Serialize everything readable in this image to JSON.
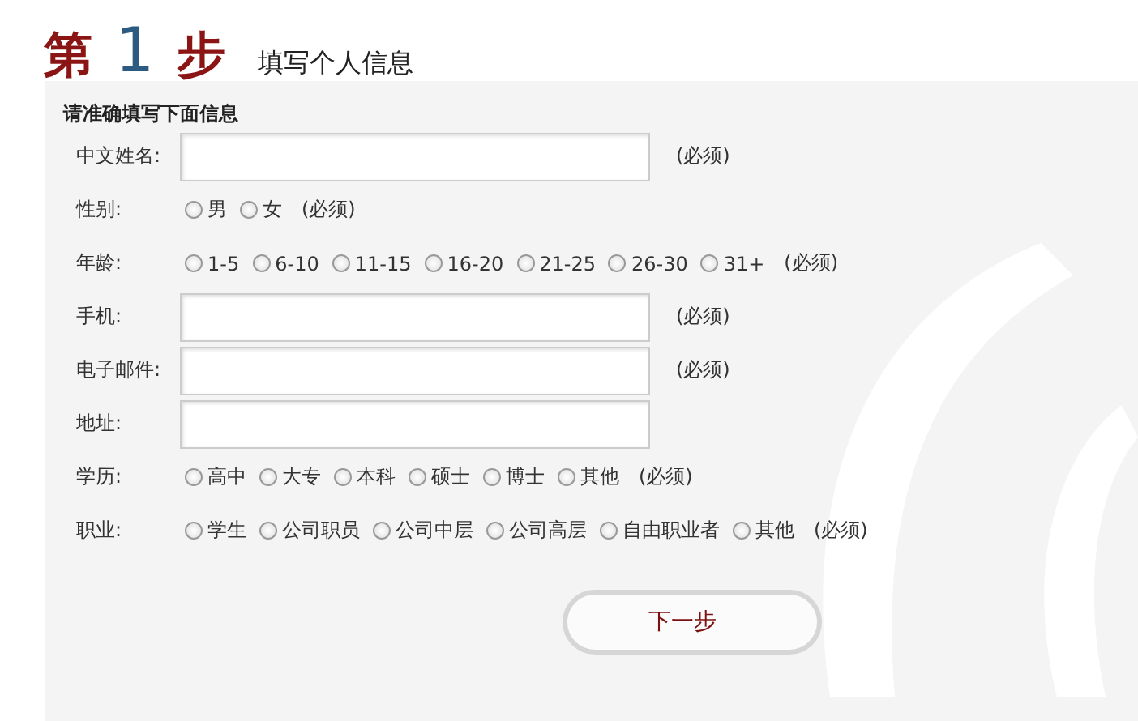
{
  "heading": {
    "step_word_1": "第",
    "step_number": "1",
    "step_word_2": "步",
    "subtitle": "填写个人信息"
  },
  "form": {
    "title": "请准确填写下面信息",
    "rows": [
      {
        "kind": "text",
        "label": "中文姓名:",
        "note": "(必须)"
      },
      {
        "kind": "radio",
        "label": "性别:",
        "options": [
          {
            "label": "男",
            "selected": false
          },
          {
            "label": "女",
            "selected": false
          }
        ],
        "note": "(必须)"
      },
      {
        "kind": "radio",
        "label": "年龄:",
        "options": [
          {
            "label": "1-5",
            "selected": false
          },
          {
            "label": "6-10",
            "selected": false
          },
          {
            "label": "11-15",
            "selected": false
          },
          {
            "label": "16-20",
            "selected": false
          },
          {
            "label": "21-25",
            "selected": false
          },
          {
            "label": "26-30",
            "selected": false
          },
          {
            "label": "31+",
            "selected": false
          }
        ],
        "note": "(必须)"
      },
      {
        "kind": "text",
        "label": "手机:",
        "note": "(必须)"
      },
      {
        "kind": "text",
        "label": "电子邮件:",
        "note": "(必须)"
      },
      {
        "kind": "text",
        "label": "地址:"
      },
      {
        "kind": "radio",
        "label": "学历:",
        "options": [
          {
            "label": "高中",
            "selected": false
          },
          {
            "label": "大专",
            "selected": false
          },
          {
            "label": "本科",
            "selected": false
          },
          {
            "label": "硕士",
            "selected": false
          },
          {
            "label": "博士",
            "selected": false
          },
          {
            "label": "其他",
            "selected": false
          }
        ],
        "note": "(必须)"
      },
      {
        "kind": "radio",
        "label": "职业:",
        "options": [
          {
            "label": "学生",
            "selected": false
          },
          {
            "label": "公司职员",
            "selected": false
          },
          {
            "label": "公司中层",
            "selected": false
          },
          {
            "label": "公司高层",
            "selected": false
          },
          {
            "label": "自由职业者",
            "selected": false
          },
          {
            "label": "其他",
            "selected": false
          }
        ],
        "note": "(必须)"
      }
    ],
    "next_button": "下一步"
  }
}
